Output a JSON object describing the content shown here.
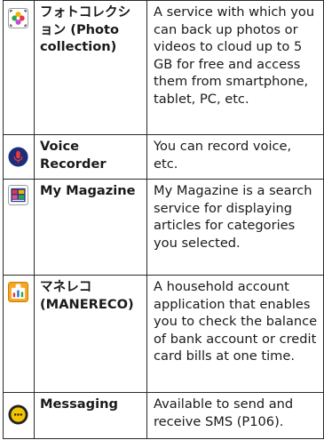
{
  "rows": [
    {
      "icon": "photo-collection-icon",
      "name": "フォトコレクション (Photo collection)",
      "description": "A service with which you can back up photos or videos to cloud up to 5 GB for free and access them from smartphone, tablet, PC, etc."
    },
    {
      "icon": "voice-recorder-icon",
      "name": "Voice Recorder",
      "description": "You can record voice, etc."
    },
    {
      "icon": "my-magazine-icon",
      "name": "My Magazine",
      "description": "My Magazine is a search service for displaying articles for categories you selected."
    },
    {
      "icon": "manereco-icon",
      "name": "マネレコ (MANERECO)",
      "description": "A household account application that enables you to check the balance of bank account or credit card bills at one time."
    },
    {
      "icon": "messaging-icon",
      "name": "Messaging",
      "description": "Available to send and receive SMS (P106)."
    }
  ]
}
